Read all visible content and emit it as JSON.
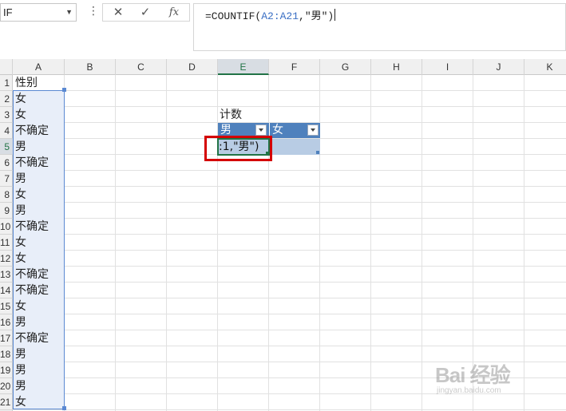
{
  "formula_bar": {
    "name_box": "IF",
    "more_glyph": "⋮",
    "cancel_glyph": "✕",
    "enter_glyph": "✓",
    "fx_glyph": "fx",
    "formula_prefix": "=COUNTIF(",
    "formula_ref": "A2:A21",
    "formula_suffix": ",″男″)"
  },
  "columns": [
    "A",
    "B",
    "C",
    "D",
    "E",
    "F",
    "G",
    "H",
    "I",
    "J",
    "K"
  ],
  "selected_column": "E",
  "rows": [
    "1",
    "2",
    "3",
    "4",
    "5",
    "6",
    "7",
    "8",
    "9",
    "10",
    "11",
    "12",
    "13",
    "14",
    "15",
    "16",
    "17",
    "18",
    "19",
    "20",
    "21"
  ],
  "selected_row": "5",
  "column_a": {
    "header": "性别",
    "values": [
      "女",
      "女",
      "不确定",
      "男",
      "不确定",
      "男",
      "女",
      "男",
      "不确定",
      "女",
      "女",
      "不确定",
      "不确定",
      "女",
      "男",
      "不确定",
      "男",
      "男",
      "男",
      "女"
    ]
  },
  "summary_table": {
    "label": "计数",
    "header_e": "男",
    "header_f": "女",
    "e5_edit_text": ":1,\"男\")"
  },
  "watermark": {
    "text": "Bai 经验",
    "url": "jingyan.baidu.com"
  },
  "colors": {
    "table_header": "#4f81bd",
    "table_row": "#b8cce4",
    "selection": "#5b89d2",
    "highlight_box": "#d40000",
    "active_cell": "#217346"
  }
}
